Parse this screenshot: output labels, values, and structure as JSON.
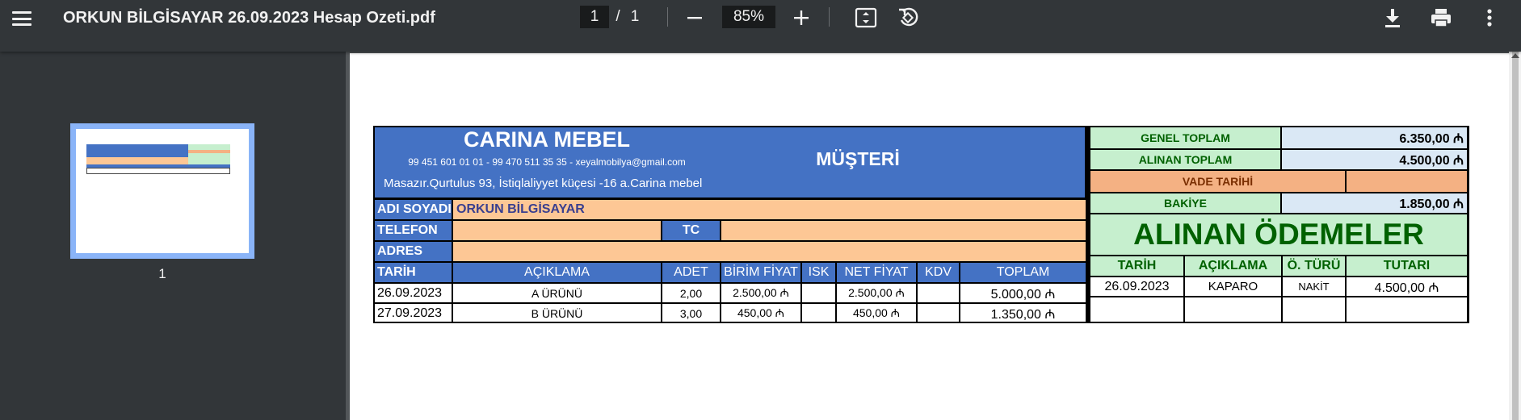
{
  "toolbar": {
    "title": "ORKUN BİLGİSAYAR 26.09.2023 Hesap Ozeti.pdf",
    "page_current": "1",
    "page_separator": "/",
    "page_total": "1",
    "zoom": "85%",
    "icons": [
      "menu-icon",
      "zoom-out-icon",
      "zoom-in-icon",
      "fit-page-icon",
      "rotate-icon",
      "download-icon",
      "print-icon",
      "more-icon"
    ]
  },
  "sidebar": {
    "thumbnail_label": "1"
  },
  "document": {
    "company_name": "CARINA MEBEL",
    "company_contact": "99 451 601 01 01 - 99 470 511 35 35 -  xeyalmobilya@gmail.com",
    "company_address": "Masazır.Qurtulus 93, İstiqlaliyyet küçesi -16 a.Carina mebel",
    "customer_header": "MÜŞTERİ",
    "labels": {
      "name": "ADI SOYADI",
      "phone": "TELEFON",
      "tc": "TC",
      "address": "ADRES"
    },
    "customer": {
      "name": "ORKUN BİLGİSAYAR",
      "phone": "",
      "tc": "",
      "address": ""
    },
    "sales_columns": [
      "TARİH",
      "AÇIKLAMA",
      "ADET",
      "BİRİM FİYAT",
      "ISK",
      "NET FİYAT",
      "KDV",
      "TOPLAM"
    ],
    "sales_rows": [
      {
        "date": "26.09.2023",
        "desc": "A ÜRÜNÜ",
        "qty": "2,00",
        "unit": "2.500,00 ₼",
        "disc": "",
        "net": "2.500,00 ₼",
        "vat": "",
        "total": "5.000,00 ₼"
      },
      {
        "date": "27.09.2023",
        "desc": "B ÜRÜNÜ",
        "qty": "3,00",
        "unit": "450,00 ₼",
        "disc": "",
        "net": "450,00 ₼",
        "vat": "",
        "total": "1.350,00 ₼"
      }
    ],
    "summary": {
      "general_total_label": "GENEL TOPLAM",
      "general_total_value": "6.350,00 ₼",
      "received_total_label": "ALINAN TOPLAM",
      "received_total_value": "4.500,00 ₼",
      "due_date_label": "VADE TARİHİ",
      "due_date_value": "",
      "balance_label": "BAKİYE",
      "balance_value": "1.850,00 ₼"
    },
    "payments_title": "ALINAN ÖDEMELER",
    "payment_columns": [
      "TARİH",
      "AÇIKLAMA",
      "Ö. TÜRÜ",
      "TUTARI"
    ],
    "payment_rows": [
      {
        "date": "26.09.2023",
        "desc": "KAPARO",
        "type": "NAKİT",
        "amount": "4.500,00 ₼"
      },
      {
        "date": "",
        "desc": "",
        "type": "",
        "amount": ""
      }
    ]
  }
}
